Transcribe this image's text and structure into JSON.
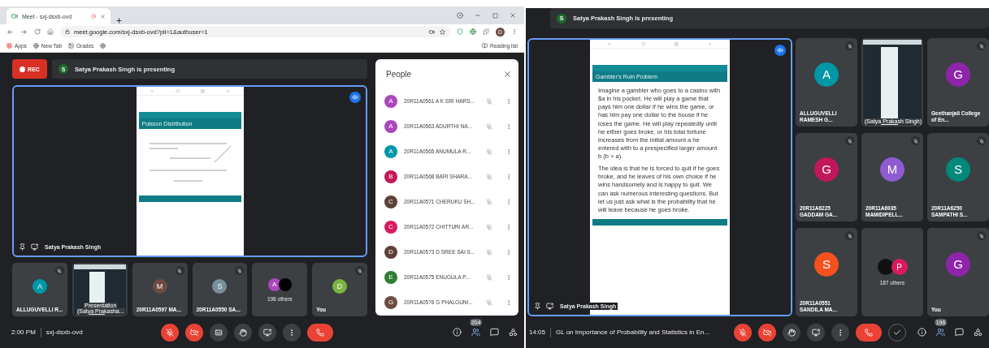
{
  "left": {
    "browser": {
      "tab_title": "Meet - sxj-dsxb-ovd",
      "url": "meet.google.com/sxj-dsxb-ovd?pli=1&authuser=1",
      "profile_initial": "D",
      "bookmarks": [
        "Apps",
        "New Tab",
        "Grades"
      ],
      "reading_list": "Reading list"
    },
    "rec": "REC",
    "presenting": {
      "initial": "S",
      "text": "Satya Prakash Singh is presenting"
    },
    "main_tile": {
      "slide_title": "Poisson Distribution",
      "name": "Satya Prakash Singh"
    },
    "tiles": [
      {
        "kind": "avatar",
        "initial": "A",
        "color": "#0097a7",
        "name": "ALLUGUVELLI R...",
        "muted": true
      },
      {
        "kind": "screen",
        "lines": [
          "Presentation",
          "(Satya Prakasha..."
        ],
        "muted": false
      },
      {
        "kind": "avatar",
        "initial": "M",
        "color": "#6d4c41",
        "name": "20R11A0597 MA...",
        "muted": true
      },
      {
        "kind": "avatar",
        "initial": "S",
        "color": "#78909c",
        "name": "20R11A0550 SA...",
        "muted": true
      },
      {
        "kind": "others",
        "avatars": [
          {
            "initial": "A",
            "color": "#ab47bc"
          },
          {
            "color": "#000000"
          }
        ],
        "name": "198 others",
        "muted": false
      },
      {
        "kind": "avatar",
        "initial": "D",
        "color": "#7cb342",
        "name": "You",
        "muted": true
      }
    ],
    "people": {
      "title": "People",
      "list": [
        {
          "initial": "A",
          "color": "#ab47bc",
          "name": "20R11A0561 A K SRI HARS..."
        },
        {
          "initial": "A",
          "color": "#ab47bc",
          "name": "20R11A0563 ADURTHI NA..."
        },
        {
          "initial": "A",
          "color": "#0097a7",
          "name": "20R11A0565 ANUMULA R..."
        },
        {
          "initial": "B",
          "color": "#c2185b",
          "name": "20R11A0568 BARI SHARA..."
        },
        {
          "initial": "C",
          "color": "#5d4037",
          "name": "20R11A0571 CHERUKU SH..."
        },
        {
          "initial": "C",
          "color": "#d81b60",
          "name": "20R11A0572 CHITTURI AR..."
        },
        {
          "initial": "D",
          "color": "#5d4037",
          "name": "20R11A0573 D SREE SAI S..."
        },
        {
          "initial": "E",
          "color": "#2e7d32",
          "name": "20R11A0575 ENUGULA P..."
        },
        {
          "initial": "G",
          "color": "#6d4c41",
          "name": "20R11A0576 G PHALGUNI..."
        }
      ]
    },
    "meeting": {
      "time": "2:00 PM",
      "code": "sxj-dsxb-ovd"
    },
    "controls": [
      {
        "kind": "mic",
        "off": true
      },
      {
        "kind": "camera",
        "off": true
      },
      {
        "kind": "captions"
      },
      {
        "kind": "hand"
      },
      {
        "kind": "present"
      },
      {
        "kind": "more"
      },
      {
        "kind": "leave"
      }
    ],
    "participant_count": "204"
  },
  "right": {
    "presenting": {
      "initial": "S",
      "text": "Satya Prakash Singh is presenting"
    },
    "main_tile": {
      "slide_title": "Gambler's Ruin Problem",
      "paragraphs": [
        "Imagine a gambler who goes to a casino with $a in his pocket. He will play a game that pays him one dollar if he wins the game, or has him pay one dollar to the house if he loses the game. He will play repeatedly until he either goes broke, or his total fortune increases from the initial amount a he entered with to a prespecified larger amount b (b > a).",
        "The idea is that he is forced to quit if he goes broke, and he leaves of his own choice if he wins handsomely and is happy to quit. We can ask numerous interesting questions. But let us just ask what is the probability that he will leave because he goes broke."
      ],
      "name": "Satya Prakash Singh"
    },
    "tiles": [
      {
        "kind": "avatar",
        "initial": "A",
        "color": "#0097a7",
        "name": "ALLUGUVELLI RAMESH G...",
        "muted": true
      },
      {
        "kind": "screen",
        "lines": [
          "(Satya Prakash Singh)"
        ],
        "muted": false
      },
      {
        "kind": "avatar",
        "initial": "G",
        "color": "#8e24aa",
        "name": "Geethanjali College of En...",
        "muted": true
      },
      {
        "kind": "avatar",
        "initial": "G",
        "color": "#c2185b",
        "name": "20R11A6225 GADDAM GA...",
        "muted": true
      },
      {
        "kind": "avatar",
        "initial": "M",
        "color": "#8e5bd1",
        "name": "20R11A6935 MAMIDIPELL...",
        "muted": true
      },
      {
        "kind": "avatar",
        "initial": "S",
        "color": "#00897b",
        "name": "20R11A6250 SAMPATHI S...",
        "muted": true
      },
      {
        "kind": "avatar",
        "initial": "S",
        "color": "#f4511e",
        "name": "20R11A0551 SANDILA MA...",
        "muted": true
      },
      {
        "kind": "others",
        "avatars": [
          {
            "color": "#111111"
          },
          {
            "initial": "P",
            "color": "#d81b60"
          }
        ],
        "name": "187 others",
        "muted": false
      },
      {
        "kind": "avatar",
        "initial": "G",
        "color": "#8e24aa",
        "name": "You",
        "muted": true
      }
    ],
    "meeting": {
      "time": "14:05",
      "code": "GL on Importance of Probability and Statistics in En..."
    },
    "controls": [
      {
        "kind": "mic",
        "off": true
      },
      {
        "kind": "camera",
        "off": true
      },
      {
        "kind": "hand"
      },
      {
        "kind": "present"
      },
      {
        "kind": "more"
      },
      {
        "kind": "leave"
      },
      {
        "kind": "check"
      }
    ],
    "participant_count": "196"
  }
}
